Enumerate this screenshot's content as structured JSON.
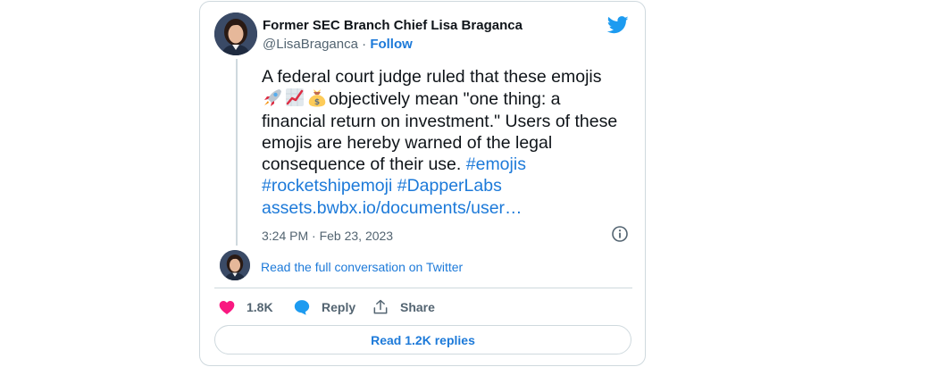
{
  "author": {
    "name": "Former SEC Branch Chief Lisa Braganca",
    "handle": "@LisaBraganca",
    "separator": "·",
    "follow_label": "Follow"
  },
  "tweet": {
    "line1": "A federal court judge ruled that these emojis",
    "line2_text": "objectively mean \"one thing: a",
    "line3": "financial return on investment.\" Users of these",
    "line4": "emojis are hereby warned of the legal",
    "line5_text": "consequence of their use. ",
    "hashtag1": "#emojis",
    "hashtag2": "#rocketshipemoji",
    "hashtag3": "#DapperLabs",
    "url": "assets.bwbx.io/documents/user…",
    "emojis": [
      "rocket-icon",
      "chart-increasing-icon",
      "money-bag-icon"
    ]
  },
  "timestamp": "3:24 PM · Feb 23, 2023",
  "read_conversation": "Read the full conversation on Twitter",
  "actions": {
    "likes_count": "1.8K",
    "reply_label": "Reply",
    "share_label": "Share"
  },
  "read_replies": "Read 1.2K replies",
  "colors": {
    "link": "#1d7ad9",
    "twitter_blue": "#1d9bf0",
    "like_pink": "#f91880",
    "muted": "#536471",
    "border": "#cfd9de"
  }
}
